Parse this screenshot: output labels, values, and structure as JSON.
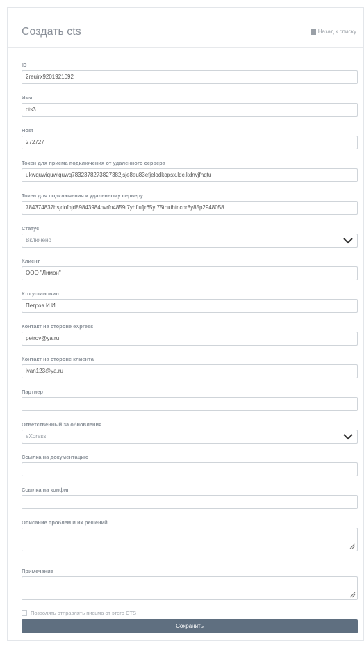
{
  "header": {
    "title": "Создать cts",
    "back_label": "Назад к списку"
  },
  "fields": {
    "id": {
      "label": "ID",
      "value": "2reuirx9201921092"
    },
    "name": {
      "label": "Имя",
      "value": "cts3"
    },
    "host": {
      "label": "Host",
      "value": "272727"
    },
    "token_in": {
      "label": "Токен для приема подключения от удаленного сервера",
      "value": "ukwquwiquwiquwq7832378273827382jsje8eu83efjelodkopsx,ldc,kdnvjfnqtu"
    },
    "token_out": {
      "label": "Токен для подключения к удаленному серверу",
      "value": "784374837hsjdofhjd89843984nvrfn4859t7yhfiufjr65yt75thuihfncor8y85p2948058"
    },
    "status": {
      "label": "Статус",
      "value": "Включено"
    },
    "client": {
      "label": "Клиент",
      "value": "ООО \"Лимон\""
    },
    "installer": {
      "label": "Кто установил",
      "value": "Петров И.И."
    },
    "contact_express": {
      "label": "Контакт на стороне eXpress",
      "value": "petrov@ya.ru"
    },
    "contact_client": {
      "label": "Контакт на стороне клиента",
      "value": "ivan123@ya.ru"
    },
    "partner": {
      "label": "Партнер",
      "value": ""
    },
    "update_responsible": {
      "label": "Ответственный за обновления",
      "value": "eXpress"
    },
    "doc_link": {
      "label": "Ссылка на документацию",
      "value": ""
    },
    "config_link": {
      "label": "Ссылка на конфиг",
      "value": ""
    },
    "problems": {
      "label": "Описание проблем и их решений",
      "value": ""
    },
    "note": {
      "label": "Примечание",
      "value": ""
    }
  },
  "checkbox_label": "Позволять отправлять письма от этого CTS",
  "save_label": "Сохранить",
  "icons": {
    "back": "list-icon",
    "dropdown": "chevron-down-icon",
    "resize": "resize-handle-icon"
  },
  "colors": {
    "button": "#5f6f80",
    "border": "#cfd4d9",
    "label": "#8b929a"
  }
}
